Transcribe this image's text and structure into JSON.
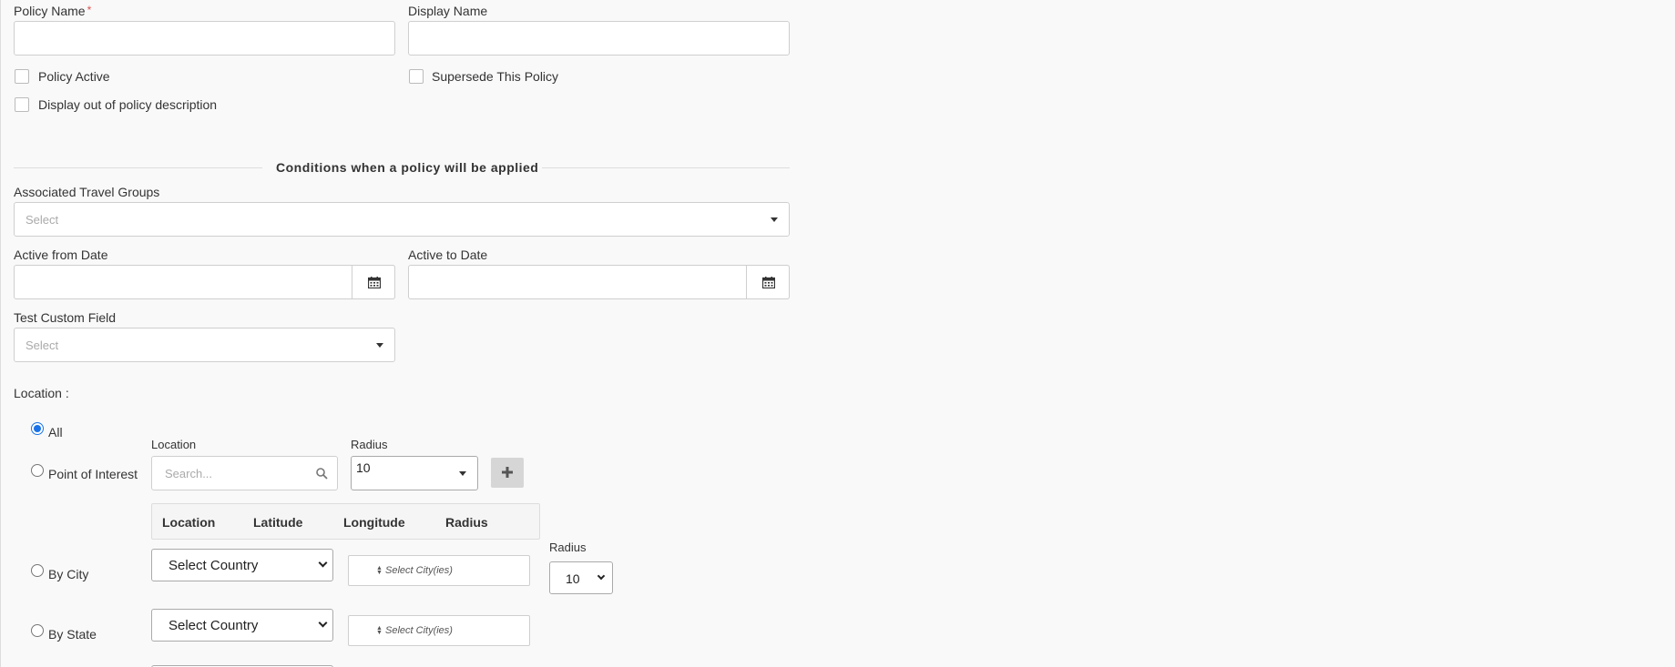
{
  "fields": {
    "policy_name_label": "Policy Name",
    "required_mark": "*",
    "display_name_label": "Display Name",
    "policy_active_label": "Policy Active",
    "supersede_label": "Supersede This Policy",
    "display_out_label": "Display out of policy description"
  },
  "conditions": {
    "section_title": "Conditions when a policy will be applied",
    "travel_groups_label": "Associated Travel Groups",
    "travel_groups_placeholder": "Select",
    "active_from_label": "Active from Date",
    "active_to_label": "Active to Date",
    "custom_field_label": "Test Custom Field",
    "custom_field_placeholder": "Select"
  },
  "location": {
    "label": "Location :",
    "options": {
      "all": "All",
      "poi": "Point of Interest",
      "city": "By City",
      "state": "By State"
    },
    "selected": "all",
    "poi": {
      "location_label": "Location",
      "search_placeholder": "Search...",
      "radius_label": "Radius",
      "radius_value": "10"
    },
    "table_headers": [
      "Location",
      "Latitude",
      "Longitude",
      "Radius"
    ],
    "by_city": {
      "country_select": "Select Country",
      "city_select": "Select City(ies)",
      "radius_label": "Radius",
      "radius_value": "10"
    },
    "by_state": {
      "country_select": "Select Country",
      "city_select": "Select City(ies)"
    }
  },
  "colors": {
    "accent": "#1a73e8",
    "required": "#d9534f",
    "background": "#f9f9f9"
  }
}
